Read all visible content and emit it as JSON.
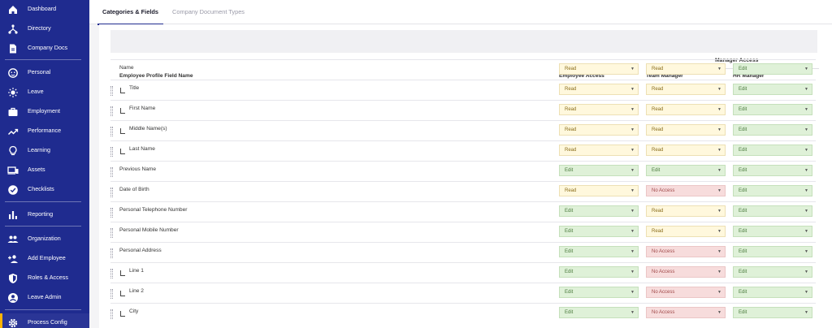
{
  "sidebar": {
    "items": [
      {
        "label": "Dashboard",
        "icon": "home-icon"
      },
      {
        "label": "Directory",
        "icon": "hierarchy-icon"
      },
      {
        "label": "Company Docs",
        "icon": "document-icon"
      },
      {
        "label": "Personal",
        "icon": "face-icon"
      },
      {
        "label": "Leave",
        "icon": "sun-icon"
      },
      {
        "label": "Employment",
        "icon": "briefcase-icon"
      },
      {
        "label": "Performance",
        "icon": "trending-up-icon"
      },
      {
        "label": "Learning",
        "icon": "lightbulb-icon"
      },
      {
        "label": "Assets",
        "icon": "devices-icon"
      },
      {
        "label": "Checklists",
        "icon": "check-circle-icon"
      },
      {
        "label": "Reporting",
        "icon": "bar-chart-icon"
      },
      {
        "label": "Organization",
        "icon": "people-icon"
      },
      {
        "label": "Add Employee",
        "icon": "add-person-icon"
      },
      {
        "label": "Roles & Access",
        "icon": "shield-icon"
      },
      {
        "label": "Leave Admin",
        "icon": "account-circle-icon"
      },
      {
        "label": "Process Config",
        "icon": "gear-icon",
        "active": true
      }
    ],
    "accent_color": "#ffb300",
    "background": "#1f2b8f"
  },
  "tabs": [
    {
      "label": "Categories & Fields",
      "active": true
    },
    {
      "label": "Company Document Types",
      "active": false
    }
  ],
  "table": {
    "group_header": "Manager Access",
    "headers": {
      "field_name": "Employee Profile Field Name",
      "employee_access": "Employee Access",
      "team_manager": "Team Manager",
      "hr_manager": "HR Manager"
    },
    "rows": [
      {
        "name": "Name",
        "child": false,
        "employee": "Read",
        "team": "Read",
        "hr": "Edit"
      },
      {
        "name": "Title",
        "child": true,
        "employee": "Read",
        "team": "Read",
        "hr": "Edit"
      },
      {
        "name": "First Name",
        "child": true,
        "employee": "Read",
        "team": "Read",
        "hr": "Edit"
      },
      {
        "name": "Middle Name(s)",
        "child": true,
        "employee": "Read",
        "team": "Read",
        "hr": "Edit"
      },
      {
        "name": "Last Name",
        "child": true,
        "employee": "Read",
        "team": "Read",
        "hr": "Edit"
      },
      {
        "name": "Previous Name",
        "child": false,
        "employee": "Edit",
        "team": "Edit",
        "hr": "Edit"
      },
      {
        "name": "Date of Birth",
        "child": false,
        "employee": "Read",
        "team": "No Access",
        "hr": "Edit"
      },
      {
        "name": "Personal Telephone Number",
        "child": false,
        "employee": "Edit",
        "team": "Read",
        "hr": "Edit"
      },
      {
        "name": "Personal Mobile Number",
        "child": false,
        "employee": "Edit",
        "team": "Read",
        "hr": "Edit"
      },
      {
        "name": "Personal Address",
        "child": false,
        "employee": "Edit",
        "team": "No Access",
        "hr": "Edit"
      },
      {
        "name": "Line 1",
        "child": true,
        "employee": "Edit",
        "team": "No Access",
        "hr": "Edit"
      },
      {
        "name": "Line 2",
        "child": true,
        "employee": "Edit",
        "team": "No Access",
        "hr": "Edit"
      },
      {
        "name": "City",
        "child": true,
        "employee": "Edit",
        "team": "No Access",
        "hr": "Edit"
      }
    ]
  },
  "colors": {
    "read_bg": "#fff8dd",
    "edit_bg": "#dff1d8",
    "no_access_bg": "#f7dcdc"
  }
}
